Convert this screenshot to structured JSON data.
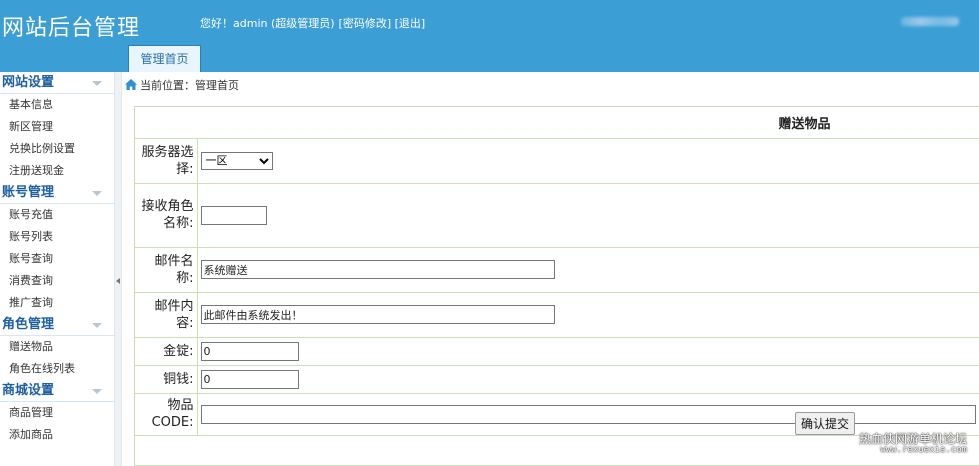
{
  "header": {
    "brand": "网站后台管理",
    "greeting_prefix": "您好！admin (超级管理员)",
    "change_password": "[密码修改]",
    "logout": "[退出]",
    "top_tab": "管理首页"
  },
  "sidebar": {
    "groups": [
      {
        "title": "网站设置",
        "items": [
          "基本信息",
          "新区管理",
          "兑换比例设置",
          "注册送现金"
        ]
      },
      {
        "title": "账号管理",
        "items": [
          "账号充值",
          "账号列表",
          "账号查询",
          "消费查询",
          "推广查询"
        ]
      },
      {
        "title": "角色管理",
        "items": [
          "赠送物品",
          "角色在线列表"
        ]
      },
      {
        "title": "商城设置",
        "items": [
          "商品管理",
          "添加商品"
        ]
      }
    ]
  },
  "breadcrumb": "当前位置：管理首页",
  "form": {
    "title": "赠送物品",
    "server_label": "服务器选择:",
    "server_value": "一区",
    "role_label": "接收角色名称:",
    "role_value": "",
    "mail_name_label": "邮件名称:",
    "mail_name_value": "系统赠送",
    "mail_content_label": "邮件内容:",
    "mail_content_value": "此邮件由系统发出！",
    "gold_label": "金锭:",
    "gold_value": "0",
    "copper_label": "铜钱:",
    "copper_value": "0",
    "item_code_label": "物品CODE:",
    "item_code_value": "",
    "submit_label": "确认提交"
  },
  "watermark": {
    "line1": "热血侠网游单机论坛",
    "line2": "www.rexuexia.com"
  }
}
